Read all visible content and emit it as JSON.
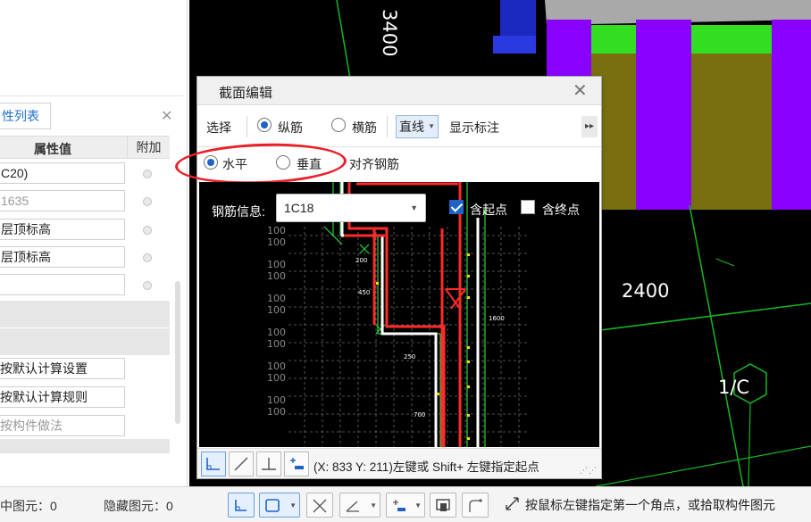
{
  "property_panel": {
    "tab_label": "性列表",
    "header_value": "属性值",
    "header_add": "附加",
    "rows": [
      "C20)",
      "1635",
      "层顶标高",
      "层顶标高",
      ""
    ],
    "buttons": [
      "按默认计算设置",
      "按默认计算规则",
      "按构件做法"
    ]
  },
  "cad": {
    "dim_top": "3400",
    "dim_right": "2400",
    "axis_label": "1/C",
    "colors": {
      "green": "#33dd22",
      "purple": "#8a00ff",
      "olive": "#787010",
      "grey": "#a9a9a9"
    }
  },
  "dialog": {
    "title": "截面编辑",
    "toolbar": {
      "select_label": "选择",
      "longitudinal": "纵筋",
      "stirrup": "横筋",
      "line_mode": "直线",
      "show_mark": "显示标注"
    },
    "row2": {
      "horizontal": "水平",
      "vertical": "垂直",
      "align": "对齐钢筋"
    },
    "rebar_info_label": "钢筋信息:",
    "rebar_value": "1C18",
    "include_start": "含起点",
    "include_end": "含终点",
    "drawing": {
      "dims": [
        "200",
        "450",
        "250",
        "700",
        "1600"
      ],
      "ticks": [
        "100",
        "100",
        "100",
        "100",
        "100",
        "100",
        "100",
        "100",
        "100",
        "100",
        "100",
        "100"
      ]
    },
    "coord_hint": "(X: 833 Y: 211)左键或 Shift+ 左键指定起点"
  },
  "status": {
    "selected": "中图元：0",
    "hidden": "隐藏图元：0",
    "hint": "按鼠标左键指定第一个角点，或拾取构件图元"
  }
}
